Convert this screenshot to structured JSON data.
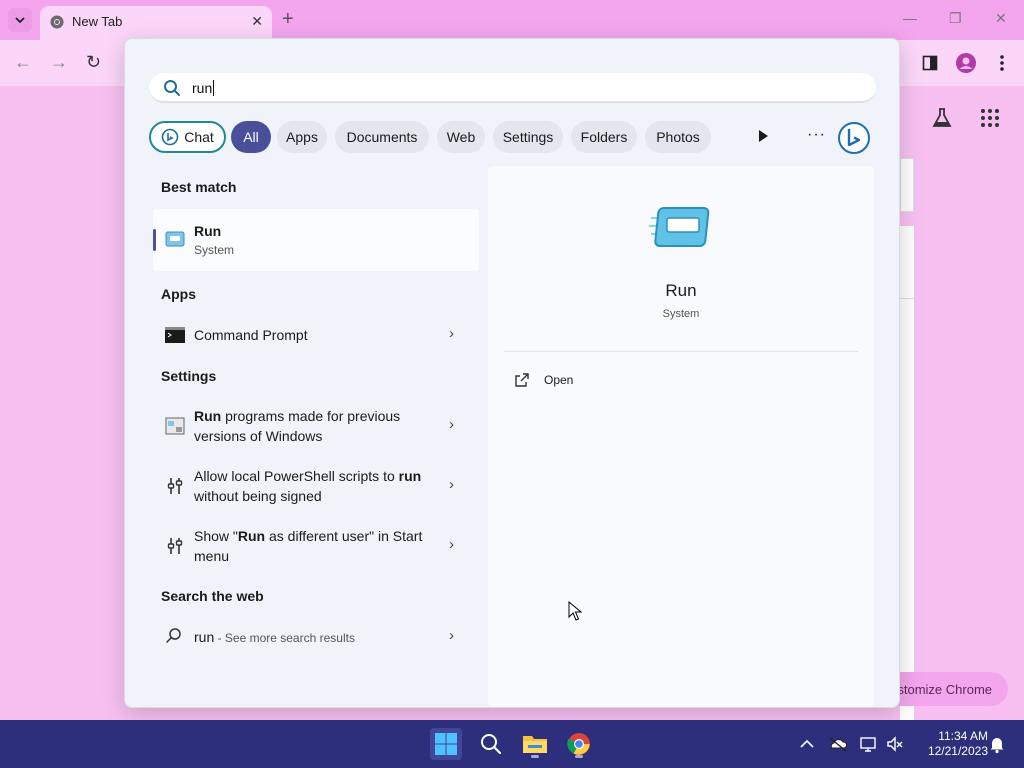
{
  "browser": {
    "tab_title": "New Tab",
    "new_tab_label": "+",
    "customize_label": "stomize Chrome"
  },
  "start": {
    "search": {
      "value": "run"
    },
    "filters": [
      "Chat",
      "All",
      "Apps",
      "Documents",
      "Web",
      "Settings",
      "Folders",
      "Photos"
    ],
    "active_filter": "All",
    "sections": {
      "best_match": "Best match",
      "apps": "Apps",
      "settings": "Settings",
      "web": "Search the web"
    },
    "best_match": {
      "name": "Run",
      "subtitle": "System"
    },
    "apps": [
      {
        "name": "Command Prompt"
      }
    ],
    "settings": [
      {
        "bold": "Run",
        "rest": " programs made for previous versions of Windows"
      },
      {
        "pre": "Allow local PowerShell scripts to ",
        "bold": "run",
        "rest": " without being signed"
      },
      {
        "pre": "Show \"",
        "bold": "Run",
        "rest": " as different user\" in Start menu"
      }
    ],
    "web": {
      "query": "run",
      "suffix": " - See more search results"
    },
    "preview": {
      "title": "Run",
      "subtitle": "System",
      "action": "Open"
    }
  },
  "taskbar": {
    "time": "11:34 AM",
    "date": "12/21/2023"
  },
  "colors": {
    "accent": "#4a4f9a",
    "taskbar": "#2d2f7c",
    "browser_frame": "#f3a6ee",
    "chat_border": "#1f8a8f"
  },
  "icons": [
    "search-icon",
    "run-icon",
    "command-prompt-icon",
    "settings-app-icon",
    "script-settings-icon",
    "chevron-right-icon",
    "open-external-icon",
    "bing-icon",
    "windows-start-icon",
    "file-explorer-icon",
    "chrome-icon",
    "notification-bell-icon"
  ]
}
